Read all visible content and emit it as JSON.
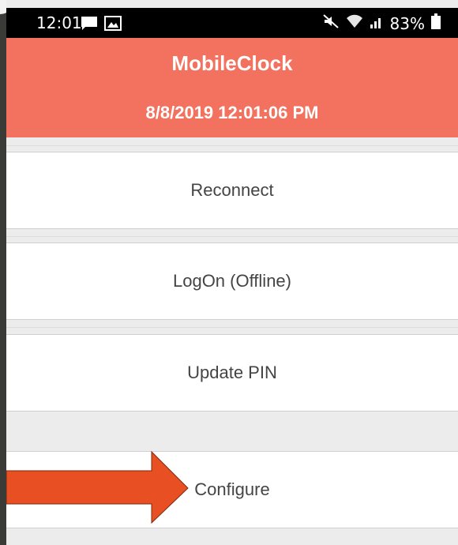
{
  "status_bar": {
    "time": "12:01",
    "battery": "83%"
  },
  "header": {
    "title": "MobileClock",
    "datetime": "8/8/2019  12:01:06 PM"
  },
  "menu": {
    "items": [
      {
        "label": "Reconnect"
      },
      {
        "label": "LogOn (Offline)"
      },
      {
        "label": "Update PIN"
      },
      {
        "label": "Configure"
      }
    ]
  },
  "colors": {
    "header": "#f2725f",
    "arrow": "#e84f22"
  },
  "icons": [
    "chat-icon",
    "gallery-icon",
    "mute-icon",
    "wifi-icon",
    "signal-icon",
    "battery-icon",
    "arrow-pointer"
  ]
}
